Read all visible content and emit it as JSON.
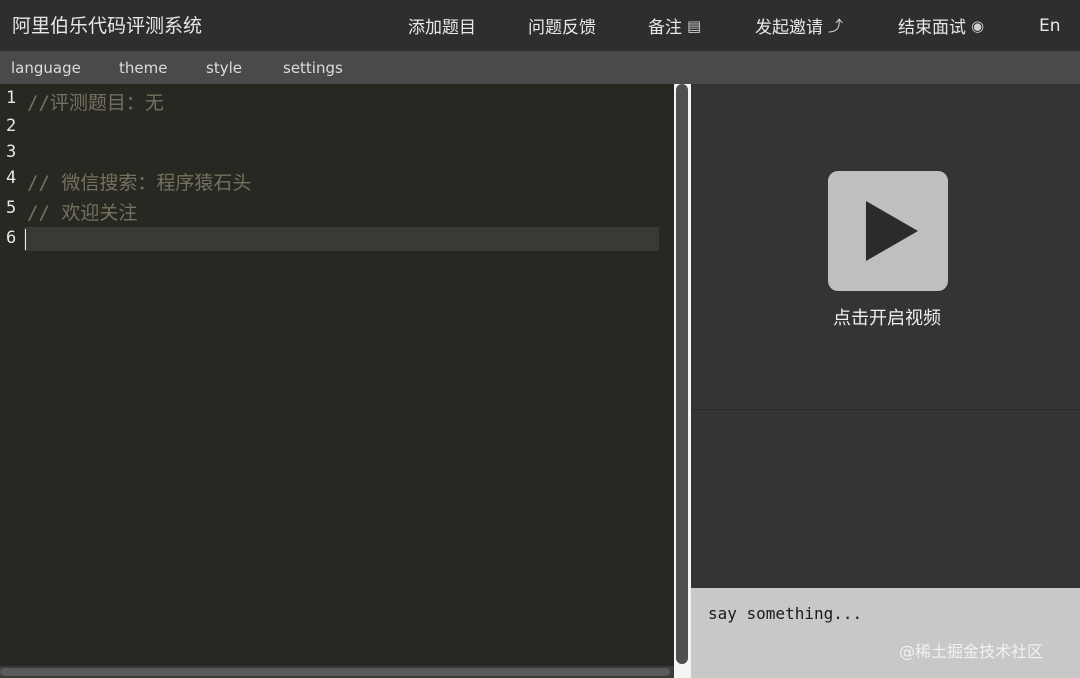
{
  "header": {
    "title": "阿里伯乐代码评测系统",
    "nav": [
      {
        "label": "添加题目",
        "icon": ""
      },
      {
        "label": "问题反馈",
        "icon": ""
      },
      {
        "label": "备注",
        "icon": "notepad-icon",
        "glyph": "▤"
      },
      {
        "label": "发起邀请",
        "icon": "share-icon",
        "glyph": "⤴"
      },
      {
        "label": "结束面试",
        "icon": "stop-circle-icon",
        "glyph": "◉"
      },
      {
        "label": "En",
        "icon": ""
      }
    ]
  },
  "toolbar": {
    "items": [
      "language",
      "theme",
      "style",
      "settings"
    ]
  },
  "editor": {
    "lines": [
      {
        "number": "1",
        "text": "//评测题目：无"
      },
      {
        "number": "2",
        "text": ""
      },
      {
        "number": "3",
        "text": ""
      },
      {
        "number": "4",
        "text": "// 微信搜索：程序猿石头"
      },
      {
        "number": "5",
        "text": "// 欢迎关注"
      },
      {
        "number": "6",
        "text": ""
      }
    ]
  },
  "video": {
    "play_icon": "play-icon",
    "label": "点击开启视频"
  },
  "chat": {
    "placeholder": "say something..."
  },
  "watermark": "@稀土掘金技术社区",
  "colors": {
    "editor_bg": "#272822",
    "comment": "#75715e",
    "topbar": "#2e2e2e",
    "toolbar": "#4a4a4a",
    "panel": "#343434"
  }
}
